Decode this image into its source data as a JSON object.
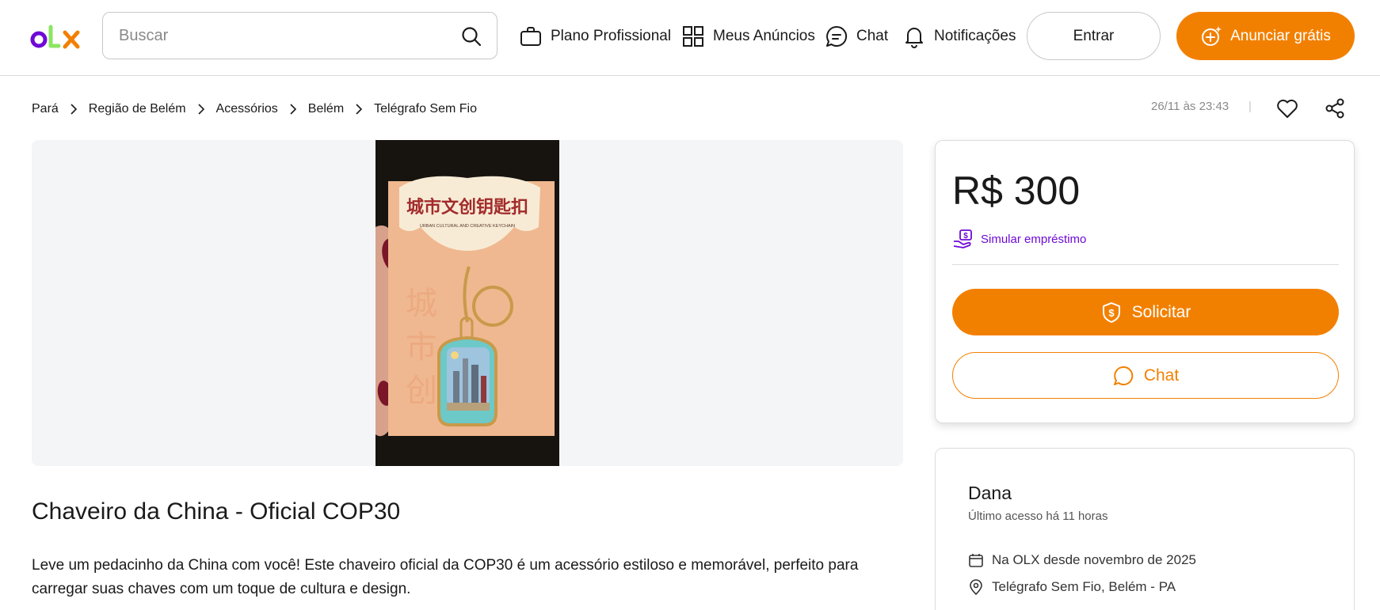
{
  "header": {
    "logo_text": "OLX",
    "search_placeholder": "Buscar",
    "nav": [
      {
        "label": "Plano Profissional",
        "icon": "briefcase-icon"
      },
      {
        "label": "Meus Anúncios",
        "icon": "grid-icon"
      },
      {
        "label": "Chat",
        "icon": "chat-bubble-icon"
      },
      {
        "label": "Notificações",
        "icon": "bell-icon"
      }
    ],
    "login_label": "Entrar",
    "post_ad_label": "Anunciar grátis"
  },
  "breadcrumb": [
    "Pará",
    "Região de Belém",
    "Acessórios",
    "Belém",
    "Telégrafo Sem Fio"
  ],
  "meta": {
    "posted_at": "26/11 às 23:43",
    "separator": "|"
  },
  "gallery": {
    "photo_text_cn": "城市文创钥匙扣",
    "photo_text_en": "URBAN CULTURAL AND CREATIVE KEYCHAIN"
  },
  "ad": {
    "title": "Chaveiro da China - Oficial COP30",
    "description": "Leve um pedacinho da China com você! Este chaveiro oficial da COP30 é um acessório estiloso e memorável, perfeito para carregar suas chaves com um toque de cultura e design."
  },
  "price_card": {
    "price": "R$ 300",
    "loan_label": "Simular empréstimo",
    "request_label": "Solicitar",
    "chat_label": "Chat"
  },
  "seller": {
    "name": "Dana",
    "last_access": "Último acesso há 11 horas",
    "member_since": "Na OLX desde novembro de 2025",
    "location": "Telégrafo Sem Fio, Belém - PA"
  },
  "colors": {
    "brand_orange": "#f28000",
    "brand_purple": "#6e0ad6",
    "brand_green": "#8ce563"
  }
}
